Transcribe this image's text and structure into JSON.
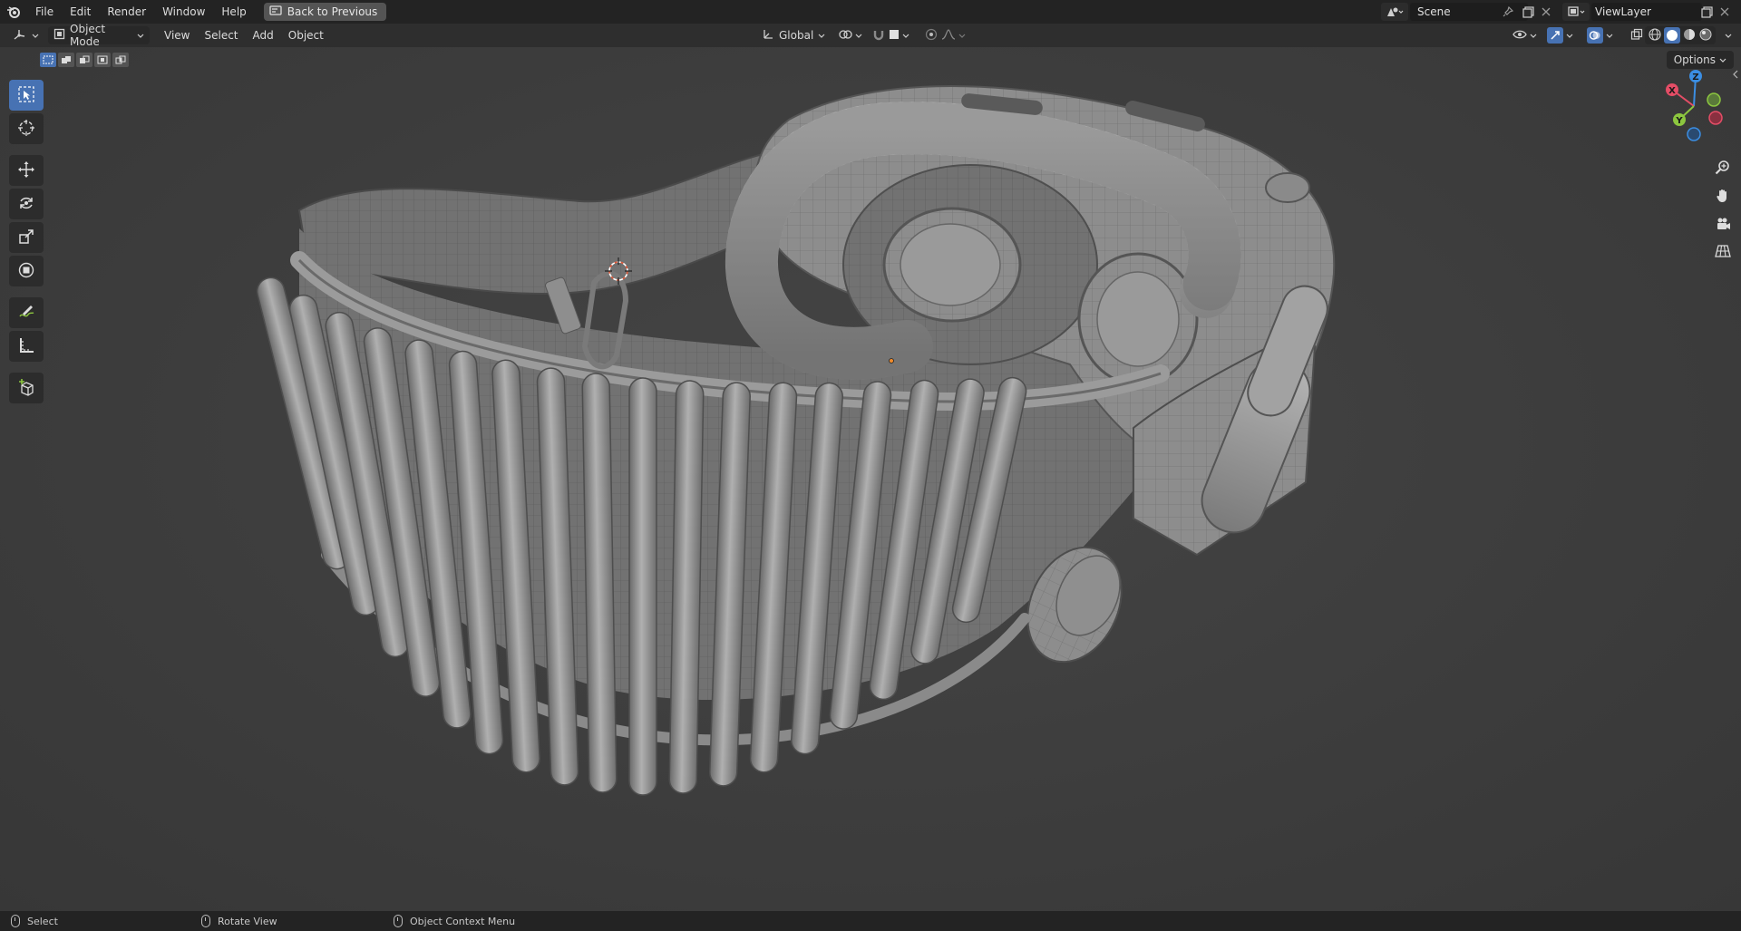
{
  "topbar": {
    "menus": [
      "File",
      "Edit",
      "Render",
      "Window",
      "Help"
    ],
    "back_label": "Back to Previous",
    "scene_name": "Scene",
    "view_layer": "ViewLayer"
  },
  "header": {
    "mode": "Object Mode",
    "menus": [
      "View",
      "Select",
      "Add",
      "Object"
    ],
    "transform_orientation": "Global",
    "options_label": "Options"
  },
  "gizmo": {
    "x_label": "X",
    "y_label": "Y",
    "z_label": "Z"
  },
  "toolbar": {
    "tools": [
      "select-box",
      "cursor",
      "move",
      "rotate",
      "scale",
      "transform",
      "annotate",
      "measure",
      "add-cube"
    ],
    "active_tool": "select-box"
  },
  "statusbar": {
    "select": "Select",
    "rotate": "Rotate View",
    "context": "Object Context Menu"
  },
  "colors": {
    "accent": "#4772b3",
    "axis_x": "#e44d66",
    "axis_y": "#8cc63f",
    "axis_z": "#3b8ee3",
    "background": "#3d3d3d"
  }
}
